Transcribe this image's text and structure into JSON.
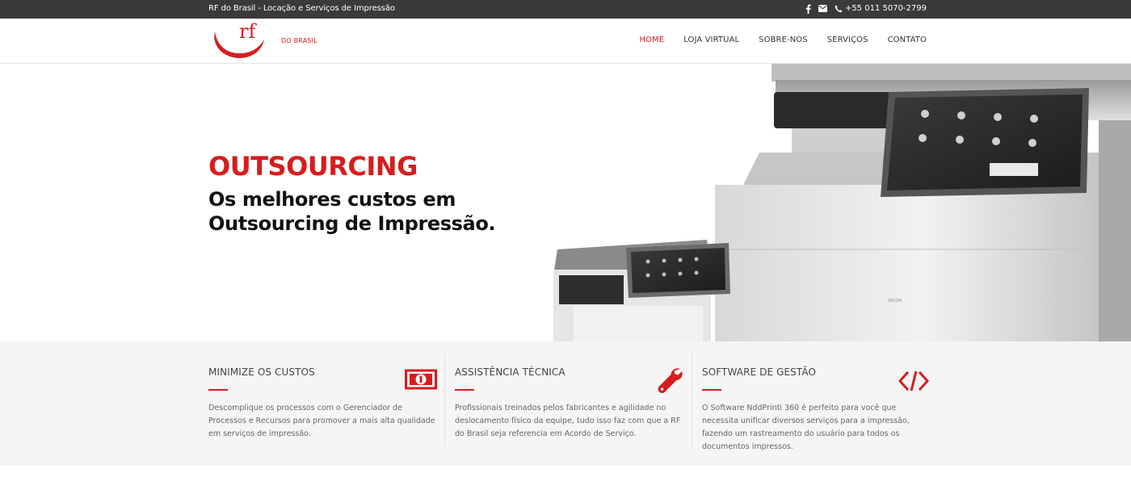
{
  "topbar": {
    "tagline": "RF do Brasil - Locação e Serviços de Impressão",
    "phone": "+55 011 5070-2799",
    "icons": [
      "facebook-icon",
      "email-icon",
      "phone-icon"
    ]
  },
  "header": {
    "logo_rf": "rf",
    "logo_subtitle": "DO BRASIL",
    "nav": [
      {
        "label": "HOME",
        "active": true
      },
      {
        "label": "LOJA VIRTUAL",
        "active": false
      },
      {
        "label": "SOBRE-NOS",
        "active": false
      },
      {
        "label": "SERVIÇOS",
        "active": false
      },
      {
        "label": "CONTATO",
        "active": false
      }
    ]
  },
  "hero": {
    "title": "OUTSOURCING",
    "subtitle": "Os melhores custos em Outsourcing de Impressão.",
    "image_alt": "printers-image"
  },
  "features": [
    {
      "title": "MINIMIZE OS CUSTOS",
      "icon": "money-icon",
      "lines": [
        "Descomplique os processos com o Gerenciador de",
        "Processos e Recursos para promover a mais alta qualidade",
        "em serviços de impressão."
      ]
    },
    {
      "title": "ASSISTÊNCIA TÉCNICA",
      "icon": "wrench-icon",
      "lines": [
        "Profissionais treinados pelos fabricantes e agilidade no",
        "deslocamento físico da equipe, tudo isso faz com que a RF",
        "do Brasil seja referencia em Acordo de Serviço."
      ]
    },
    {
      "title": "SOFTWARE DE GESTÃO",
      "icon": "code-icon",
      "lines": [
        "O Software NddPrinti 360 é perfeito para você que",
        "necessita unificar diversos serviços para a impressão,",
        "fazendo um rastreamento do usuário para todos os",
        "documentos impressos."
      ]
    }
  ],
  "colors": {
    "accent": "#d61d1d",
    "topbar_bg": "#3a3a3a",
    "features_bg": "#f5f5f5"
  }
}
